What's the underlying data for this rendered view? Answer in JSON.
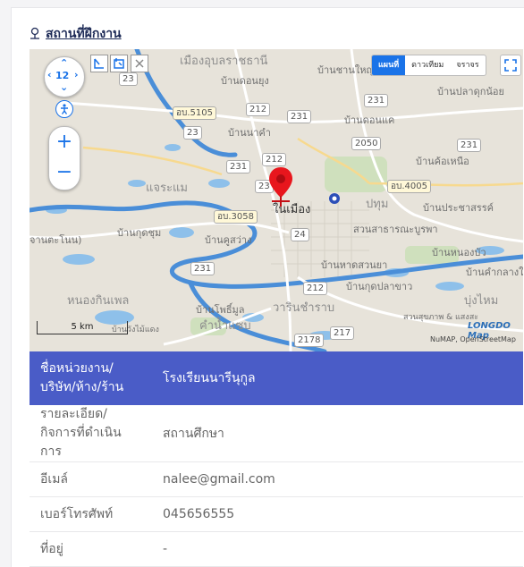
{
  "section": {
    "title": "สถานที่ฝึกงาน",
    "icon": "location-pin-icon"
  },
  "map": {
    "zoom_level": "12",
    "layers": [
      {
        "label": "แผนที่",
        "active": true
      },
      {
        "label": "ดาวเทียม",
        "active": false
      },
      {
        "label": "จราจร",
        "active": false
      }
    ],
    "scale_label": "5 km",
    "provider_logo": "LONGDO Map",
    "attribution": "NuMAP, OpenStreetMap",
    "labels": {
      "muang_ubon": "เมืองอุบลราชธานี",
      "ban_chan_yai": "บ้านชานใหญ่",
      "ban_don_yung": "บ้านดอนยุง",
      "ban_pla_duk_noi": "บ้านปลาดุกน้อย",
      "ban_na_kham": "บ้านนาคำ",
      "ban_don_kae": "บ้านดอนแค",
      "ban_kho_nuea": "บ้านค้อเหนือ",
      "chaeramae": "แจระแม",
      "pathum": "ปทุม",
      "ban_pradu_sarakham": "บ้านประชาสรรค์",
      "nai_mueang": "ในเมือง",
      "ban_kut_chum": "บ้านกุดชุม",
      "ban_khu_sawang": "บ้านคูสว่าง",
      "suan_sathana": "สวนสาธารณะบูรพา",
      "ban_nong_bua": "บ้านหนองบัว",
      "ban_kham_rai": "บ้านคำกลางใ",
      "ban_had_suan": "บ้านหาดสวนยา",
      "ban_kut_pla_khao": "บ้านกุดปลาขาว",
      "bung_mai": "บุ่งไหม",
      "nong_kin_phen": "หนองกินเพล",
      "ban_pho_mun": "บ้านโพธิ์มูล",
      "warin": "วารินชำราบ",
      "khamnam_saep": "คำน้ำแซบ",
      "suan_sukkhaphap": "สวนสุขภาพ & แสงสะ",
      "ban_wang": "บ้านวังไม้แดง",
      "left_edge": "จานตะโนน)"
    },
    "roads": {
      "r23a": "23",
      "r23b": "23",
      "r23c": "23",
      "r212a": "212",
      "r212b": "212",
      "r212c": "212",
      "r231a": "231",
      "r231b": "231",
      "r231c": "231",
      "r231d": "231",
      "r231e": "231",
      "r2050": "2050",
      "r24": "24",
      "r217": "217",
      "r2178": "2178",
      "ub5105": "อบ.5105",
      "ub4005": "อบ.4005",
      "ub3058": "อบ.3058"
    }
  },
  "info": {
    "header": {
      "label": "ชื่อหน่วยงาน/บริษัท/ห้าง/ร้าน",
      "value": "โรงเรียนนารีนุกูล"
    },
    "rows": [
      {
        "label": "รายละเอียด/กิจการที่ดำเนินการ",
        "value": "สถานศึกษา"
      },
      {
        "label": "อีเมล์",
        "value": "nalee@gmail.com"
      },
      {
        "label": "เบอร์โทรศัพท์",
        "value": "045656555"
      },
      {
        "label": "ที่อยู่",
        "value": "-"
      }
    ]
  },
  "colors": {
    "header_bg": "#4a5cc7",
    "map_river": "#4a8ed8",
    "map_water": "#8ec0ea",
    "marker": "#e8161d"
  }
}
